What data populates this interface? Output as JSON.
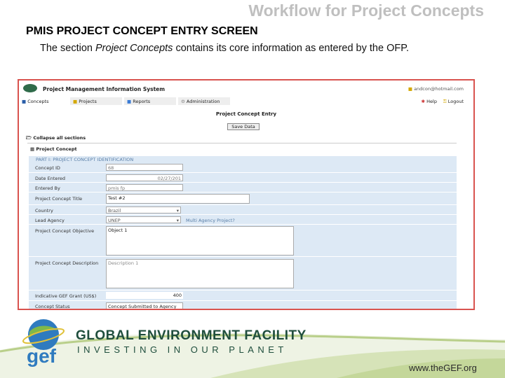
{
  "slide": {
    "title": "Workflow for Project Concepts",
    "subheading": "PMIS PROJECT CONCEPT ENTRY SCREEN",
    "para_pre": "The section ",
    "para_em": "Project Concepts",
    "para_post": " contains its core information as entered by the OFP."
  },
  "app": {
    "title": "Project Management Information System",
    "user": "andcon@hotmail.com",
    "tabs": [
      "Concepts",
      "Projects",
      "Reports",
      "Administration"
    ],
    "help": "Help",
    "logout": "Logout",
    "page_title": "Project Concept Entry",
    "save": "Save Data",
    "collapse": "Collapse all sections",
    "section": "Project Concept",
    "part": "PART I: PROJECT CONCEPT IDENTIFICATION",
    "fields": {
      "concept_id": {
        "label": "Concept ID",
        "value": "68"
      },
      "date_entered": {
        "label": "Date Entered",
        "value": "02/27/201"
      },
      "entered_by": {
        "label": "Entered By",
        "value": "pmis fp"
      },
      "title": {
        "label": "Project Concept Title",
        "value": "Test #2"
      },
      "country": {
        "label": "Country",
        "value": "Brazil"
      },
      "lead_agency": {
        "label": "Lead Agency",
        "value": "UNEP"
      },
      "multi_agency": "Multi Agency Project?",
      "objective": {
        "label": "Project Concept Objective",
        "value": "Object 1"
      },
      "description": {
        "label": "Project Concept Description",
        "value": "Description 1"
      },
      "grant": {
        "label": "Indicative GEF Grant (US$)",
        "value": "400"
      },
      "status": {
        "label": "Concept Status",
        "value": "Concept Submitted to Agency"
      }
    }
  },
  "footer": {
    "logo_text": "gef",
    "org": "GLOBAL ENVIRONMENT FACILITY",
    "tagline": "INVESTING IN OUR PLANET",
    "url": "www.theGEF.org"
  }
}
